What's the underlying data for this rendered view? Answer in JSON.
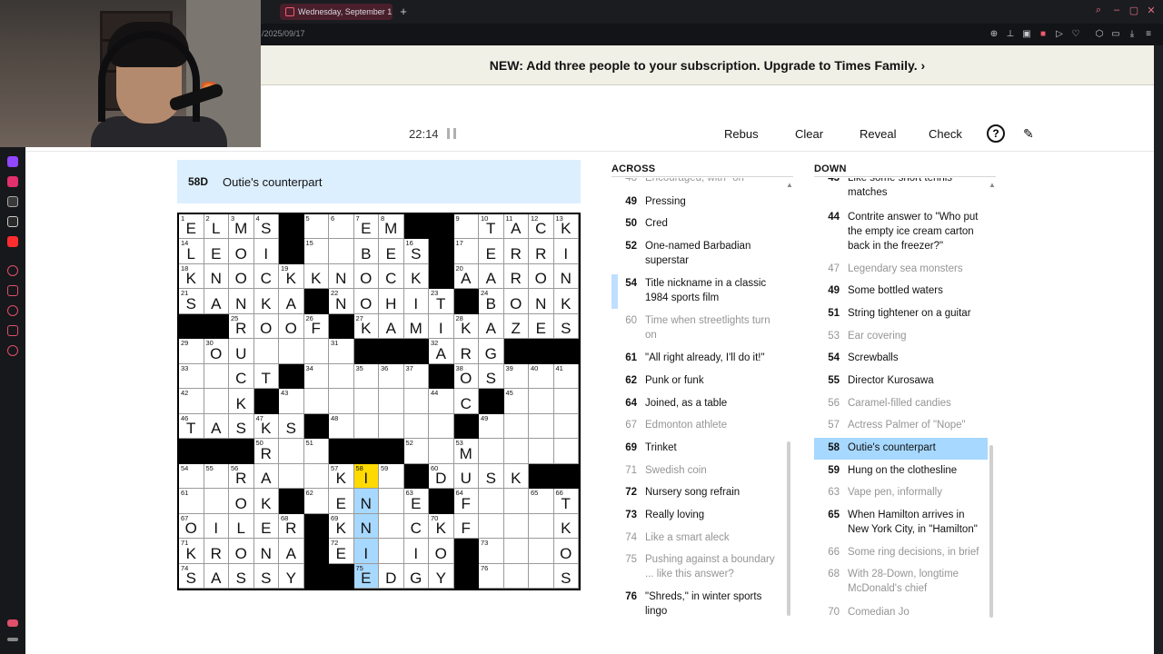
{
  "browser": {
    "tab_prev_label": "ard",
    "tab_active_label": "Wednesday, September 1",
    "url": "/2025/09/17",
    "new_tab": "+"
  },
  "banner": {
    "text": "NEW: Add three people to your subscription. Upgrade to Times Family. ›"
  },
  "toolbar": {
    "timer": "22:14",
    "rebus": "Rebus",
    "clear": "Clear",
    "reveal": "Reveal",
    "check": "Check",
    "help": "?"
  },
  "cluebar": {
    "number": "58D",
    "text": "Outie's counterpart"
  },
  "grid": {
    "rows": [
      "ELMS#..EM##.TACK",
      "LEOI#..BES#.ERRI",
      "KNOCKKNOCK#AARON",
      "SANKA#NOHIT#BONK",
      "##ROOF#KAMIKAZES",
      ".OU....###ARG###",
      ".CT#....OS.....",
      ".K#.....C#.....",
      "TASKS#.....#...",
      "###R.####..M...",
      "..RA.KI.#DUSK##",
      ".OK#EN.E#F...T",
      "OILER#KN.CKF...K",
      "KRONA#EI.IO#...O",
      "SASSY##EDGY#...S"
    ],
    "numbers": [
      [
        1,
        2,
        3,
        4,
        0,
        5,
        6,
        7,
        8,
        0,
        0,
        9,
        10,
        11,
        12,
        13
      ],
      [
        14,
        0,
        0,
        0,
        0,
        15,
        0,
        0,
        0,
        16,
        0,
        17,
        0,
        0,
        0,
        0
      ],
      [
        18,
        0,
        0,
        0,
        19,
        0,
        0,
        0,
        0,
        0,
        0,
        20,
        0,
        0,
        0,
        0
      ],
      [
        21,
        0,
        0,
        0,
        0,
        0,
        22,
        0,
        0,
        0,
        23,
        0,
        24,
        0,
        0,
        0
      ],
      [
        0,
        0,
        25,
        0,
        0,
        26,
        0,
        27,
        0,
        0,
        0,
        28,
        0,
        0,
        0,
        0
      ],
      [
        29,
        30,
        0,
        0,
        0,
        0,
        31,
        0,
        0,
        0,
        32,
        0,
        0,
        0,
        0,
        0
      ],
      [
        33,
        0,
        0,
        0,
        0,
        34,
        0,
        35,
        36,
        37,
        0,
        38,
        0,
        39,
        40,
        41
      ],
      [
        42,
        0,
        0,
        0,
        43,
        0,
        0,
        0,
        0,
        0,
        44,
        0,
        0,
        45,
        0,
        0
      ],
      [
        46,
        0,
        0,
        47,
        0,
        0,
        48,
        0,
        0,
        0,
        0,
        0,
        49,
        0,
        0,
        0
      ],
      [
        0,
        0,
        0,
        50,
        0,
        51,
        0,
        0,
        0,
        52,
        0,
        53,
        0,
        0,
        0,
        0
      ],
      [
        54,
        55,
        56,
        0,
        0,
        0,
        57,
        58,
        59,
        0,
        60,
        0,
        0,
        0,
        0,
        0
      ],
      [
        61,
        0,
        0,
        0,
        0,
        62,
        0,
        0,
        0,
        63,
        0,
        64,
        0,
        0,
        65,
        66
      ],
      [
        67,
        0,
        0,
        0,
        68,
        0,
        69,
        0,
        0,
        0,
        70,
        0,
        0,
        0,
        0,
        0
      ],
      [
        71,
        0,
        0,
        0,
        0,
        0,
        72,
        0,
        0,
        0,
        0,
        0,
        73,
        0,
        0,
        0
      ],
      [
        74,
        0,
        0,
        0,
        0,
        0,
        0,
        75,
        0,
        0,
        0,
        0,
        76,
        0,
        0,
        0
      ]
    ],
    "letters": [
      [
        "E",
        "L",
        "M",
        "S",
        "#",
        "",
        "",
        "E",
        "M",
        "#",
        "#",
        "",
        "T",
        "A",
        "C",
        "K"
      ],
      [
        "L",
        "E",
        "O",
        "I",
        "#",
        "",
        "",
        "B",
        "E",
        "S",
        "#",
        "",
        "E",
        "R",
        "R",
        "I"
      ],
      [
        "K",
        "N",
        "O",
        "C",
        "K",
        "K",
        "N",
        "O",
        "C",
        "K",
        "#",
        "A",
        "A",
        "R",
        "O",
        "N"
      ],
      [
        "S",
        "A",
        "N",
        "K",
        "A",
        "#",
        "N",
        "O",
        "H",
        "I",
        "T",
        "#",
        "B",
        "O",
        "N",
        "K"
      ],
      [
        "#",
        "#",
        "R",
        "O",
        "O",
        "F",
        "#",
        "K",
        "A",
        "M",
        "I",
        "K",
        "A",
        "Z",
        "E",
        "S"
      ],
      [
        "",
        "O",
        "U",
        "",
        "",
        "",
        "",
        "#",
        "#",
        "#",
        "A",
        "R",
        "G",
        "#",
        "#",
        "#"
      ],
      [
        "",
        "",
        "C",
        "T",
        "#",
        "",
        "",
        "",
        "",
        "",
        "#",
        "O",
        "S",
        "",
        "",
        ""
      ],
      [
        "",
        "",
        "K",
        "#",
        "",
        "",
        "",
        "",
        "",
        "",
        "",
        "C",
        "#",
        "",
        "",
        ""
      ],
      [
        "T",
        "A",
        "S",
        "K",
        "S",
        "#",
        "",
        "",
        "",
        "",
        "",
        "#",
        "",
        "",
        "",
        ""
      ],
      [
        "#",
        "#",
        "#",
        "R",
        "",
        "",
        "#",
        "#",
        "#",
        "",
        "",
        "M",
        "",
        "",
        "",
        ""
      ],
      [
        "",
        "",
        "R",
        "A",
        "",
        "",
        "K",
        "I",
        "",
        "#",
        "D",
        "U",
        "S",
        "K",
        "#",
        "#"
      ],
      [
        "",
        "",
        "O",
        "K",
        "#",
        "",
        "E",
        "N",
        "",
        "E",
        "#",
        "F",
        "",
        "",
        "",
        "T"
      ],
      [
        "O",
        "I",
        "L",
        "E",
        "R",
        "#",
        "K",
        "N",
        "",
        "C",
        "K",
        "F",
        "",
        "",
        "",
        "K"
      ],
      [
        "K",
        "R",
        "O",
        "N",
        "A",
        "#",
        "E",
        "I",
        "",
        "I",
        "O",
        "#",
        "",
        "",
        "",
        "O"
      ],
      [
        "S",
        "A",
        "S",
        "S",
        "Y",
        "#",
        "#",
        "E",
        "D",
        "G",
        "Y",
        "#",
        "",
        "",
        "",
        "S"
      ]
    ]
  },
  "across": {
    "title": "ACROSS",
    "clues": [
      {
        "n": "48",
        "t": "Encouraged, with \"on\"",
        "state": "filled"
      },
      {
        "n": "49",
        "t": "Pressing",
        "state": ""
      },
      {
        "n": "50",
        "t": "Cred",
        "state": ""
      },
      {
        "n": "52",
        "t": "One-named Barbadian superstar",
        "state": ""
      },
      {
        "n": "54",
        "t": "Title nickname in a classic 1984 sports film",
        "state": "rel"
      },
      {
        "n": "60",
        "t": "Time when streetlights turn on",
        "state": "filled"
      },
      {
        "n": "61",
        "t": "\"All right already, I'll do it!\"",
        "state": ""
      },
      {
        "n": "62",
        "t": "Punk or funk",
        "state": ""
      },
      {
        "n": "64",
        "t": "Joined, as a table",
        "state": ""
      },
      {
        "n": "67",
        "t": "Edmonton athlete",
        "state": "filled"
      },
      {
        "n": "69",
        "t": "Trinket",
        "state": ""
      },
      {
        "n": "71",
        "t": "Swedish coin",
        "state": "filled"
      },
      {
        "n": "72",
        "t": "Nursery song refrain",
        "state": ""
      },
      {
        "n": "73",
        "t": "Really loving",
        "state": ""
      },
      {
        "n": "74",
        "t": "Like a smart aleck",
        "state": "filled"
      },
      {
        "n": "75",
        "t": "Pushing against a boundary ... like this answer?",
        "state": "filled"
      },
      {
        "n": "76",
        "t": "\"Shreds,\" in winter sports lingo",
        "state": ""
      }
    ]
  },
  "down": {
    "title": "DOWN",
    "clues": [
      {
        "n": "43",
        "t": "Like some short tennis matches",
        "state": ""
      },
      {
        "n": "44",
        "t": "Contrite answer to \"Who put the empty ice cream carton back in the freezer?\"",
        "state": ""
      },
      {
        "n": "47",
        "t": "Legendary sea monsters",
        "state": "filled"
      },
      {
        "n": "49",
        "t": "Some bottled waters",
        "state": ""
      },
      {
        "n": "51",
        "t": "String tightener on a guitar",
        "state": ""
      },
      {
        "n": "53",
        "t": "Ear covering",
        "state": "filled"
      },
      {
        "n": "54",
        "t": "Screwballs",
        "state": ""
      },
      {
        "n": "55",
        "t": "Director Kurosawa",
        "state": ""
      },
      {
        "n": "56",
        "t": "Caramel-filled candies",
        "state": "filled"
      },
      {
        "n": "57",
        "t": "Actress Palmer of \"Nope\"",
        "state": "filled"
      },
      {
        "n": "58",
        "t": "Outie's counterpart",
        "state": "sel"
      },
      {
        "n": "59",
        "t": "Hung on the clothesline",
        "state": ""
      },
      {
        "n": "63",
        "t": "Vape pen, informally",
        "state": "filled"
      },
      {
        "n": "65",
        "t": "When Hamilton arrives in New York City, in \"Hamilton\"",
        "state": ""
      },
      {
        "n": "66",
        "t": "Some ring decisions, in brief",
        "state": "filled"
      },
      {
        "n": "68",
        "t": "With 28-Down, longtime McDonald's chief",
        "state": "filled"
      },
      {
        "n": "70",
        "t": "Comedian Jo",
        "state": "filled"
      }
    ]
  },
  "icons": {
    "sidebar": [
      "twitch-icon",
      "instagram-icon",
      "tiktok-icon",
      "x-icon",
      "youtube-icon",
      "player-icon",
      "bookmark-icon",
      "history-icon",
      "extension-icon",
      "settings-icon"
    ],
    "colors": {
      "accent": "#ffda00",
      "word": "#a7d8ff",
      "cluebar": "#dcefff"
    }
  }
}
